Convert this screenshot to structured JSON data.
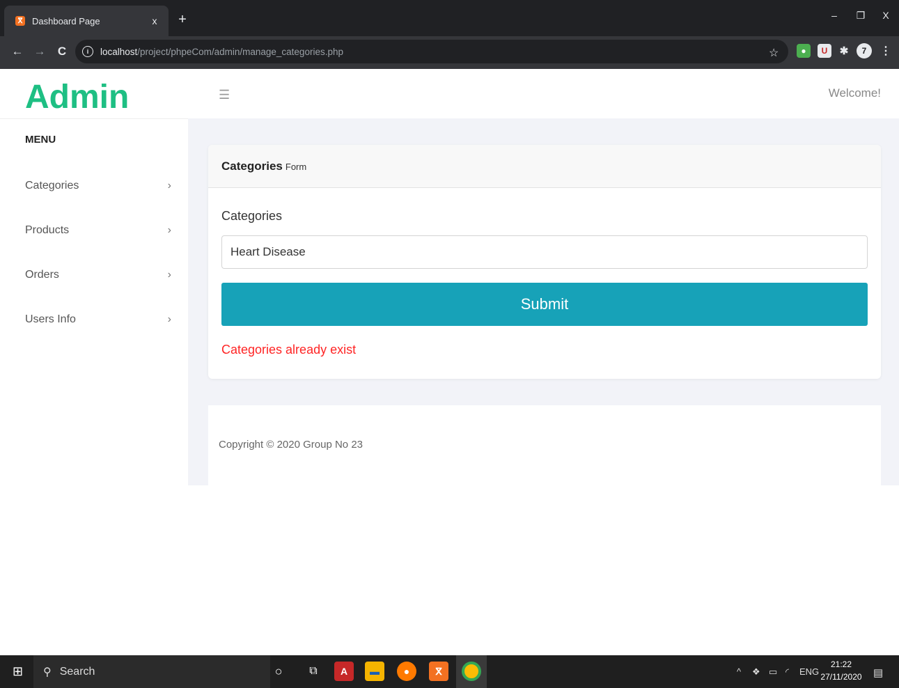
{
  "browser": {
    "tab_title": "Dashboard Page",
    "tab_close": "x",
    "new_tab": "+",
    "url_host": "localhost",
    "url_path": "/project/phpeCom/admin/manage_categories.php",
    "window_minimize": "–",
    "window_restore": "❐",
    "window_close": "X",
    "extension_badge": "7"
  },
  "sidebar": {
    "logo": "Admin",
    "menu_title": "MENU",
    "items": [
      {
        "label": "Categories"
      },
      {
        "label": "Products"
      },
      {
        "label": "Orders"
      },
      {
        "label": "Users Info"
      }
    ]
  },
  "header": {
    "welcome": "Welcome!"
  },
  "form": {
    "title_bold": "Categories",
    "title_small": "Form",
    "field_label": "Categories",
    "field_value": "Heart Disease",
    "submit_label": "Submit",
    "error_message": "Categories already exist"
  },
  "footer": {
    "copyright": "Copyright © 2020 Group No 23"
  },
  "taskbar": {
    "search_label": "Search",
    "language": "ENG",
    "time": "21:22",
    "date": "27/11/2020"
  },
  "colors": {
    "brand": "#1ebf83",
    "submit": "#17a2b8",
    "error": "#ff2424"
  }
}
